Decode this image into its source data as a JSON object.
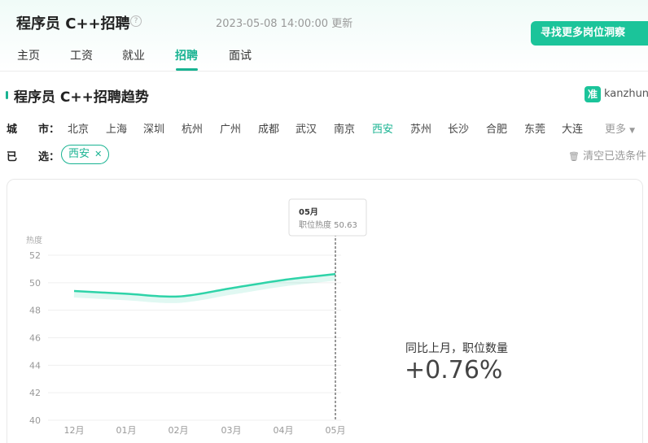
{
  "header": {
    "title": "程序员 C++招聘",
    "help_icon": "question-circle-icon",
    "updated_at": "2023-05-08 14:00:00 更新",
    "cta_label": "寻找更多岗位洞察"
  },
  "nav": {
    "tabs": [
      {
        "label": "主页",
        "active": false
      },
      {
        "label": "工资",
        "active": false
      },
      {
        "label": "就业",
        "active": false
      },
      {
        "label": "招聘",
        "active": true
      },
      {
        "label": "面试",
        "active": false
      }
    ]
  },
  "section": {
    "title": "程序员 C++招聘趋势",
    "brand_icon_char": "准",
    "brand_name": "kanzhun"
  },
  "filters": {
    "city_label": "城　　市：",
    "cities": [
      {
        "label": "北京",
        "active": false
      },
      {
        "label": "上海",
        "active": false
      },
      {
        "label": "深圳",
        "active": false
      },
      {
        "label": "杭州",
        "active": false
      },
      {
        "label": "广州",
        "active": false
      },
      {
        "label": "成都",
        "active": false
      },
      {
        "label": "武汉",
        "active": false
      },
      {
        "label": "南京",
        "active": false
      },
      {
        "label": "西安",
        "active": true
      },
      {
        "label": "苏州",
        "active": false
      },
      {
        "label": "长沙",
        "active": false
      },
      {
        "label": "合肥",
        "active": false
      },
      {
        "label": "东莞",
        "active": false
      },
      {
        "label": "大连",
        "active": false
      }
    ],
    "more_label": "更多",
    "selected_label": "已　　选：",
    "selected": [
      {
        "label": "西安",
        "remove_icon": "close-icon"
      }
    ],
    "clear_label": "清空已选条件",
    "clear_icon": "trash-icon"
  },
  "chart_data": {
    "type": "line",
    "ylabel": "热度",
    "xlabel": "",
    "categories": [
      "12月",
      "01月",
      "02月",
      "03月",
      "04月",
      "05月"
    ],
    "values": [
      49.4,
      49.2,
      49.0,
      49.6,
      50.2,
      50.63
    ],
    "ylim": [
      40,
      52
    ],
    "yticks": [
      40,
      42,
      44,
      46,
      48,
      50,
      52
    ],
    "grid": true,
    "color": "#2ed3a8",
    "tooltip": {
      "category": "05月",
      "label": "职位热度",
      "value": "50.63"
    }
  },
  "stats": {
    "label": "同比上月，职位数量",
    "value": "+0.76%"
  }
}
